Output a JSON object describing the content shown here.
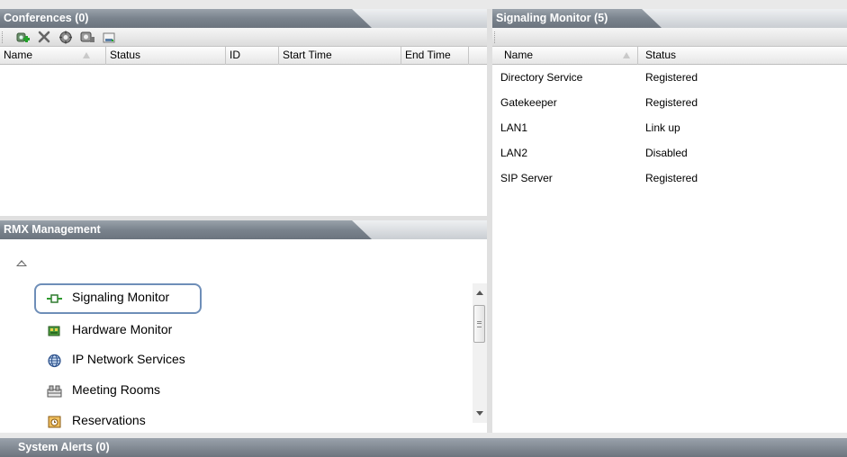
{
  "conferences": {
    "title": "Conferences (0)",
    "toolbar": {
      "icons": [
        "new-conference-icon",
        "delete-icon",
        "conference-settings-icon",
        "conference-properties-icon",
        "save-to-file-icon"
      ]
    },
    "columns": [
      "Name",
      "Status",
      "ID",
      "Start Time",
      "End Time"
    ],
    "rows": []
  },
  "rmx_management": {
    "title": "RMX Management",
    "items": [
      {
        "label": "Signaling Monitor",
        "icon": "signaling-monitor-icon"
      },
      {
        "label": "Hardware Monitor",
        "icon": "hardware-monitor-icon"
      },
      {
        "label": "IP Network Services",
        "icon": "globe-icon"
      },
      {
        "label": "Meeting Rooms",
        "icon": "meeting-rooms-icon"
      },
      {
        "label": "Reservations",
        "icon": "reservations-icon"
      }
    ]
  },
  "signaling_monitor": {
    "title": "Signaling Monitor (5)",
    "columns": [
      "Name",
      "Status"
    ],
    "rows": [
      {
        "name": "Directory Service",
        "status": "Registered"
      },
      {
        "name": "Gatekeeper",
        "status": "Registered"
      },
      {
        "name": "LAN1",
        "status": "Link up"
      },
      {
        "name": "LAN2",
        "status": "Disabled"
      },
      {
        "name": "SIP Server",
        "status": "Registered"
      }
    ]
  },
  "system_alerts": {
    "title": "System Alerts (0)"
  }
}
